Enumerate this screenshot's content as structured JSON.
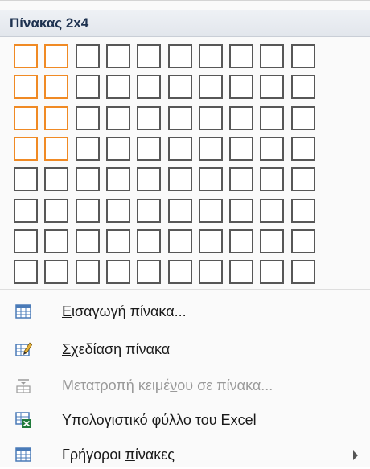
{
  "header": {
    "title": "Πίνακας 2x4"
  },
  "grid": {
    "columns": 10,
    "rows": 8,
    "selected_columns": 2,
    "selected_rows": 4
  },
  "menu": {
    "items": [
      {
        "pre": "",
        "key": "Ε",
        "post": "ισαγωγή πίνακα...",
        "icon": "insert-table-icon",
        "enabled": true
      },
      {
        "pre": "",
        "key": "Σ",
        "post": "χεδίαση πίνακα",
        "icon": "draw-table-icon",
        "enabled": true
      },
      {
        "pre": "Μετατροπή κειμέ",
        "key": "ν",
        "post": "ου σε πίνακα...",
        "icon": "convert-text-icon",
        "enabled": false
      },
      {
        "pre": "Υπολογιστικό φύλλο του E",
        "key": "x",
        "post": "cel",
        "icon": "excel-sheet-icon",
        "enabled": true
      },
      {
        "pre": "Γρήγοροι ",
        "key": "π",
        "post": "ίνακες",
        "icon": "quick-tables-icon",
        "enabled": true
      }
    ]
  },
  "colors": {
    "selected_border": "#f08a24",
    "cell_border": "#575757",
    "header_text": "#1e3250"
  }
}
